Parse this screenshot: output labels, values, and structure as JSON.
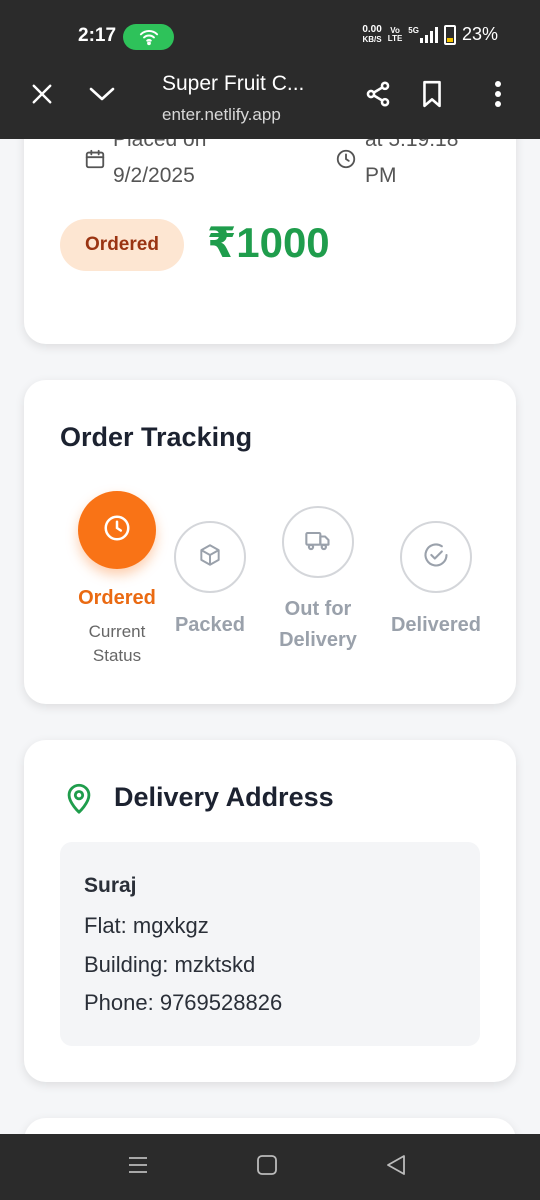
{
  "status_bar": {
    "time": "2:17",
    "net_speed_value": "0.00",
    "net_speed_unit": "KB/S",
    "volte_top": "Vo",
    "volte_bottom": "LTE",
    "network": "5G",
    "battery": "23%"
  },
  "browser": {
    "title": "Super Fruit C...",
    "url": "enter.netlify.app",
    "icons": [
      "close-icon",
      "chevron-down-icon",
      "share-icon",
      "bookmark-icon",
      "more-vert-icon"
    ]
  },
  "order_summary": {
    "placed_label": "Placed on",
    "placed_date": "9/2/2025",
    "time_label": "at 5:19:18",
    "time_suffix": "PM",
    "status_badge": "Ordered",
    "amount": "₹1000",
    "colors": {
      "amount": "#1f9d4c",
      "badge_bg": "#fde6d2",
      "badge_text": "#9a3412"
    }
  },
  "order_tracking": {
    "title": "Order Tracking",
    "steps": [
      {
        "label": "Ordered",
        "sub": "Current Status",
        "icon": "clock-icon",
        "active": true
      },
      {
        "label": "Packed",
        "icon": "box-icon",
        "active": false
      },
      {
        "label": "Out for Delivery",
        "icon": "truck-icon",
        "active": false
      },
      {
        "label": "Delivered",
        "icon": "check-circle-icon",
        "active": false
      }
    ],
    "colors": {
      "active": "#f97316",
      "inactive": "#d4d6da"
    }
  },
  "delivery_address": {
    "title": "Delivery Address",
    "icon": "map-pin-icon",
    "name": "Suraj",
    "flat": "Flat: mgxkgz",
    "building": "Building: mzktskd",
    "phone": "Phone: 9769528826"
  },
  "nav_bar": {
    "icons": [
      "recents-icon",
      "home-icon",
      "back-icon"
    ]
  }
}
